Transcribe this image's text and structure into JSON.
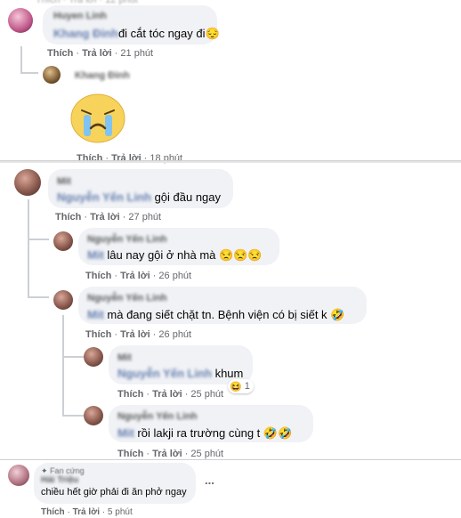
{
  "comments": [
    {
      "author": "Huyen Linh",
      "mention": "Khang Đinh",
      "text": "đi cắt tóc ngay đi",
      "emoji": "😔",
      "like": "Thích",
      "reply": "Trả lời",
      "time": "21 phút"
    },
    {
      "author": "Khang Đinh",
      "sticker": "crying-face",
      "like": "Thích",
      "reply": "Trả lời",
      "time": "18 phút"
    },
    {
      "author": "Mit",
      "mention": "Nguyễn Yến Linh",
      "text": "gội đầu ngay",
      "like": "Thích",
      "reply": "Trả lời",
      "time": "27 phút"
    },
    {
      "author": "Nguyễn Yến Linh",
      "mention": "Mit",
      "text": "lâu nay gội ở nhà mà",
      "emoji": "😒😒😒",
      "like": "Thích",
      "reply": "Trả lời",
      "time": "26 phút"
    },
    {
      "author": "Nguyễn Yến Linh",
      "mention": "Mit",
      "text": "mà đang siết chặt tn. Bệnh viện có bị siết k",
      "emoji": "🤣",
      "like": "Thích",
      "reply": "Trả lời",
      "time": "26 phút"
    },
    {
      "author": "Mit",
      "mention": "Nguyễn Yến Linh",
      "text": "khum",
      "like": "Thích",
      "reply": "Trả lời",
      "time": "25 phút",
      "reaction_emoji": "😆",
      "reaction_count": "1"
    },
    {
      "author": "Nguyễn Yến Linh",
      "mention": "Mit",
      "text": "rồi lakji ra trường cùng t",
      "emoji": "🤣🤣",
      "like": "Thích",
      "reply": "Trả lời",
      "time": "25 phút"
    },
    {
      "author": "Fan cứng",
      "badge": "Hải Triệu",
      "text": "chiều hết giờ phải đi ăn phở ngay",
      "like": "Thích",
      "reply": "Trả lời",
      "time": "5 phút",
      "more": "..."
    }
  ]
}
